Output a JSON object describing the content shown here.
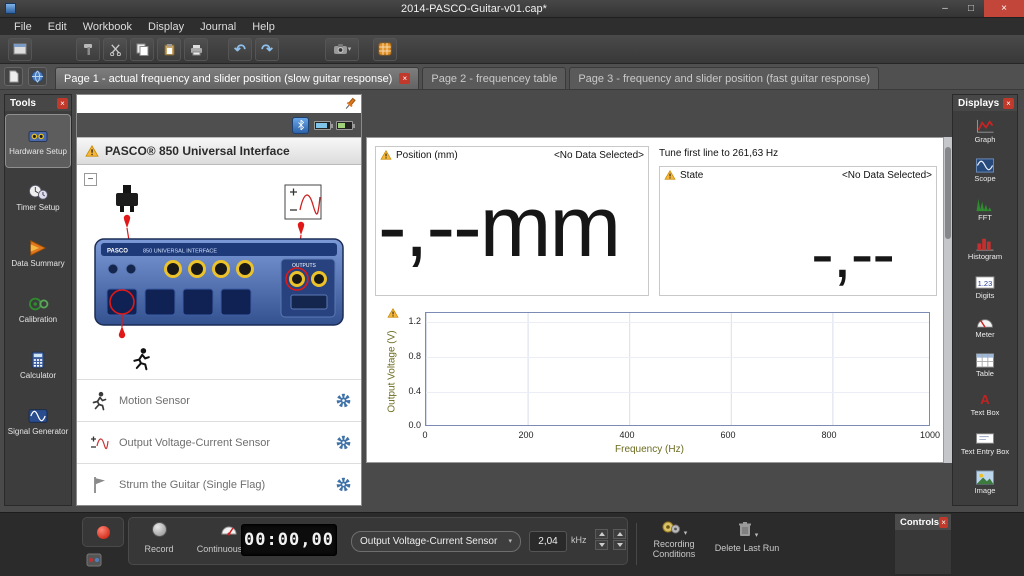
{
  "window": {
    "title": "2014-PASCO-Guitar-v01.cap*"
  },
  "icons": {
    "minimize": "–",
    "maximize": "□",
    "close_x": "×",
    "caret_down": "▾",
    "undo": "↶",
    "redo": "↷",
    "minus": "−"
  },
  "menu": {
    "items": [
      "File",
      "Edit",
      "Workbook",
      "Display",
      "Journal",
      "Help"
    ]
  },
  "tabs": {
    "items": [
      {
        "label": "Page 1 - actual frequency and slider position (slow guitar response)"
      },
      {
        "label": "Page 2 - frequencey table"
      },
      {
        "label": "Page 3 - frequency and slider position (fast guitar response)"
      }
    ]
  },
  "tools": {
    "title": "Tools",
    "items": [
      {
        "label": "Hardware Setup"
      },
      {
        "label": "Timer Setup"
      },
      {
        "label": "Data Summary"
      },
      {
        "label": "Calibration"
      },
      {
        "label": "Calculator"
      },
      {
        "label": "Signal Generator"
      }
    ]
  },
  "hardware": {
    "title": "PASCO® 850 Universal Interface",
    "brand": "PASCO",
    "device_label": "850 UNIVERSAL INTERFACE",
    "outputs_label": "OUTPUTS",
    "sensors": [
      {
        "label": "Motion Sensor"
      },
      {
        "label": "Output Voltage-Current Sensor"
      },
      {
        "label": "Strum the Guitar (Single Flag)"
      }
    ]
  },
  "digits_position": {
    "header": "Position (mm)",
    "status": "<No Data Selected>",
    "value": "-,--mm"
  },
  "digits_state": {
    "note": "Tune first line to 261,63 Hz",
    "header": "State",
    "status": "<No Data Selected>",
    "value": "-,--"
  },
  "chart_data": {
    "type": "line",
    "series": [],
    "title": "",
    "xlabel": "Frequency (Hz)",
    "ylabel": "Output Voltage (V)",
    "xlim": [
      0,
      1000
    ],
    "ylim": [
      0.0,
      1.3
    ],
    "xticks": [
      0,
      200,
      400,
      600,
      800,
      1000
    ],
    "yticks": [
      0.0,
      0.4,
      0.8,
      1.2
    ],
    "xtick_labels": [
      "0",
      "200",
      "400",
      "600",
      "800",
      "1000"
    ],
    "ytick_labels": [
      "0.0",
      "0.4",
      "0.8",
      "1.2"
    ],
    "grid": "vertical gridlines at x ticks",
    "legend": "none"
  },
  "displays": {
    "title": "Displays",
    "digits_icon_text": "1.23",
    "textbox_icon_text": "A",
    "items": [
      {
        "label": "Graph"
      },
      {
        "label": "Scope"
      },
      {
        "label": "FFT"
      },
      {
        "label": "Histogram"
      },
      {
        "label": "Digits"
      },
      {
        "label": "Meter"
      },
      {
        "label": "Table"
      },
      {
        "label": "Text Box"
      },
      {
        "label": "Text Entry Box"
      },
      {
        "label": "Image"
      }
    ]
  },
  "controls_bar": {
    "record_label": "Record",
    "mode_label": "Continuous Mode",
    "timer": "00:00,00",
    "sensor_select": "Output Voltage-Current Sensor",
    "freq_value": "2,04",
    "freq_unit": "kHz",
    "recording_conditions_label": "Recording Conditions",
    "delete_last_run_label": "Delete Last Run",
    "panel_title": "Controls"
  }
}
